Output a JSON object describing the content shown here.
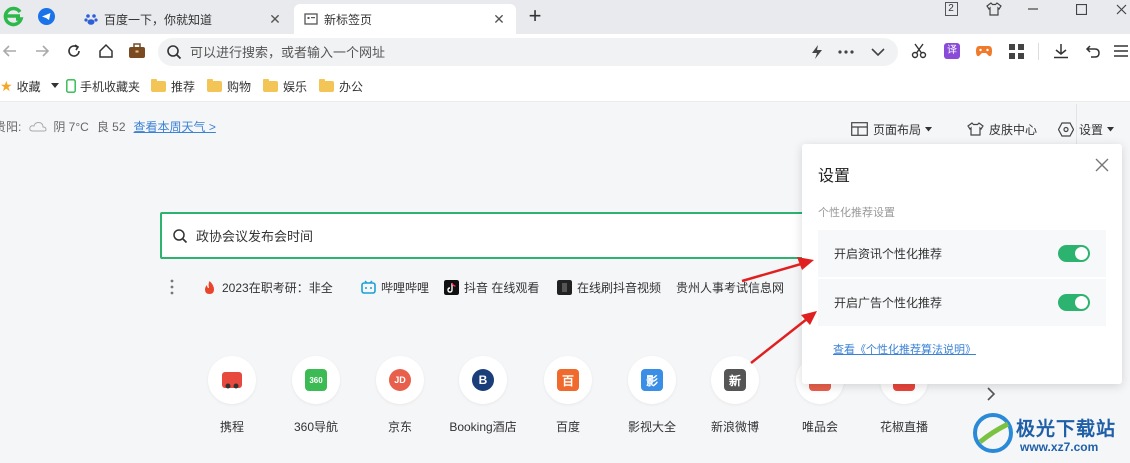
{
  "tabs": [
    {
      "label": "百度一下，你就知道",
      "icon": "baidu-paw-icon"
    },
    {
      "label": "新标签页",
      "icon": "newtab-page-icon"
    }
  ],
  "window": {
    "profile_count": "2"
  },
  "address": {
    "placeholder": "可以进行搜索，或者输入一个网址"
  },
  "bookmarks": {
    "favorites": "收藏",
    "mobile": "手机收藏夹",
    "folders": [
      "推荐",
      "购物",
      "娱乐",
      "办公"
    ]
  },
  "weather": {
    "city": "贵阳:",
    "condition": "阴 7°C",
    "aqi": "良 52",
    "link": "查看本周天气 >"
  },
  "top_actions": {
    "layout": "页面布局",
    "skin": "皮肤中心",
    "settings": "设置"
  },
  "search": {
    "placeholder": "政协会议发布会时间"
  },
  "hot_links": [
    {
      "text": "2023在职考研：非全",
      "color": "#e8452c"
    },
    {
      "text": "哔哩哔哩",
      "color": "#1ba1d6"
    },
    {
      "text": "抖音 在线观看",
      "color": "#111111"
    },
    {
      "text": "在线刷抖音视频",
      "color": "#222222"
    },
    {
      "text": "贵州人事考试信息网",
      "color": ""
    }
  ],
  "sites": [
    {
      "label": "携程",
      "glyph": "",
      "color": "#e8493e"
    },
    {
      "label": "360导航",
      "glyph": "360",
      "color": "#3cba54"
    },
    {
      "label": "京东",
      "glyph": "JD",
      "color": "#e8604c"
    },
    {
      "label": "Booking酒店",
      "glyph": "B",
      "color": "#1a3e7a"
    },
    {
      "label": "百度",
      "glyph": "百",
      "color": "#ef6a2c"
    },
    {
      "label": "影视大全",
      "glyph": "影",
      "color": "#3a8ee6"
    },
    {
      "label": "新浪微博",
      "glyph": "新",
      "color": "#555555"
    },
    {
      "label": "唯品会",
      "glyph": "",
      "color": "#e8604c"
    },
    {
      "label": "花椒直播",
      "glyph": "",
      "color": "#e8453c"
    }
  ],
  "settings_panel": {
    "title": "设置",
    "section": "个性化推荐设置",
    "rows": [
      {
        "label": "开启资讯个性化推荐",
        "on": true
      },
      {
        "label": "开启广告个性化推荐",
        "on": true
      }
    ],
    "link": "查看《个性化推荐算法说明》"
  },
  "watermark": {
    "name": "极光下载站",
    "url": "www.xz7.com"
  }
}
